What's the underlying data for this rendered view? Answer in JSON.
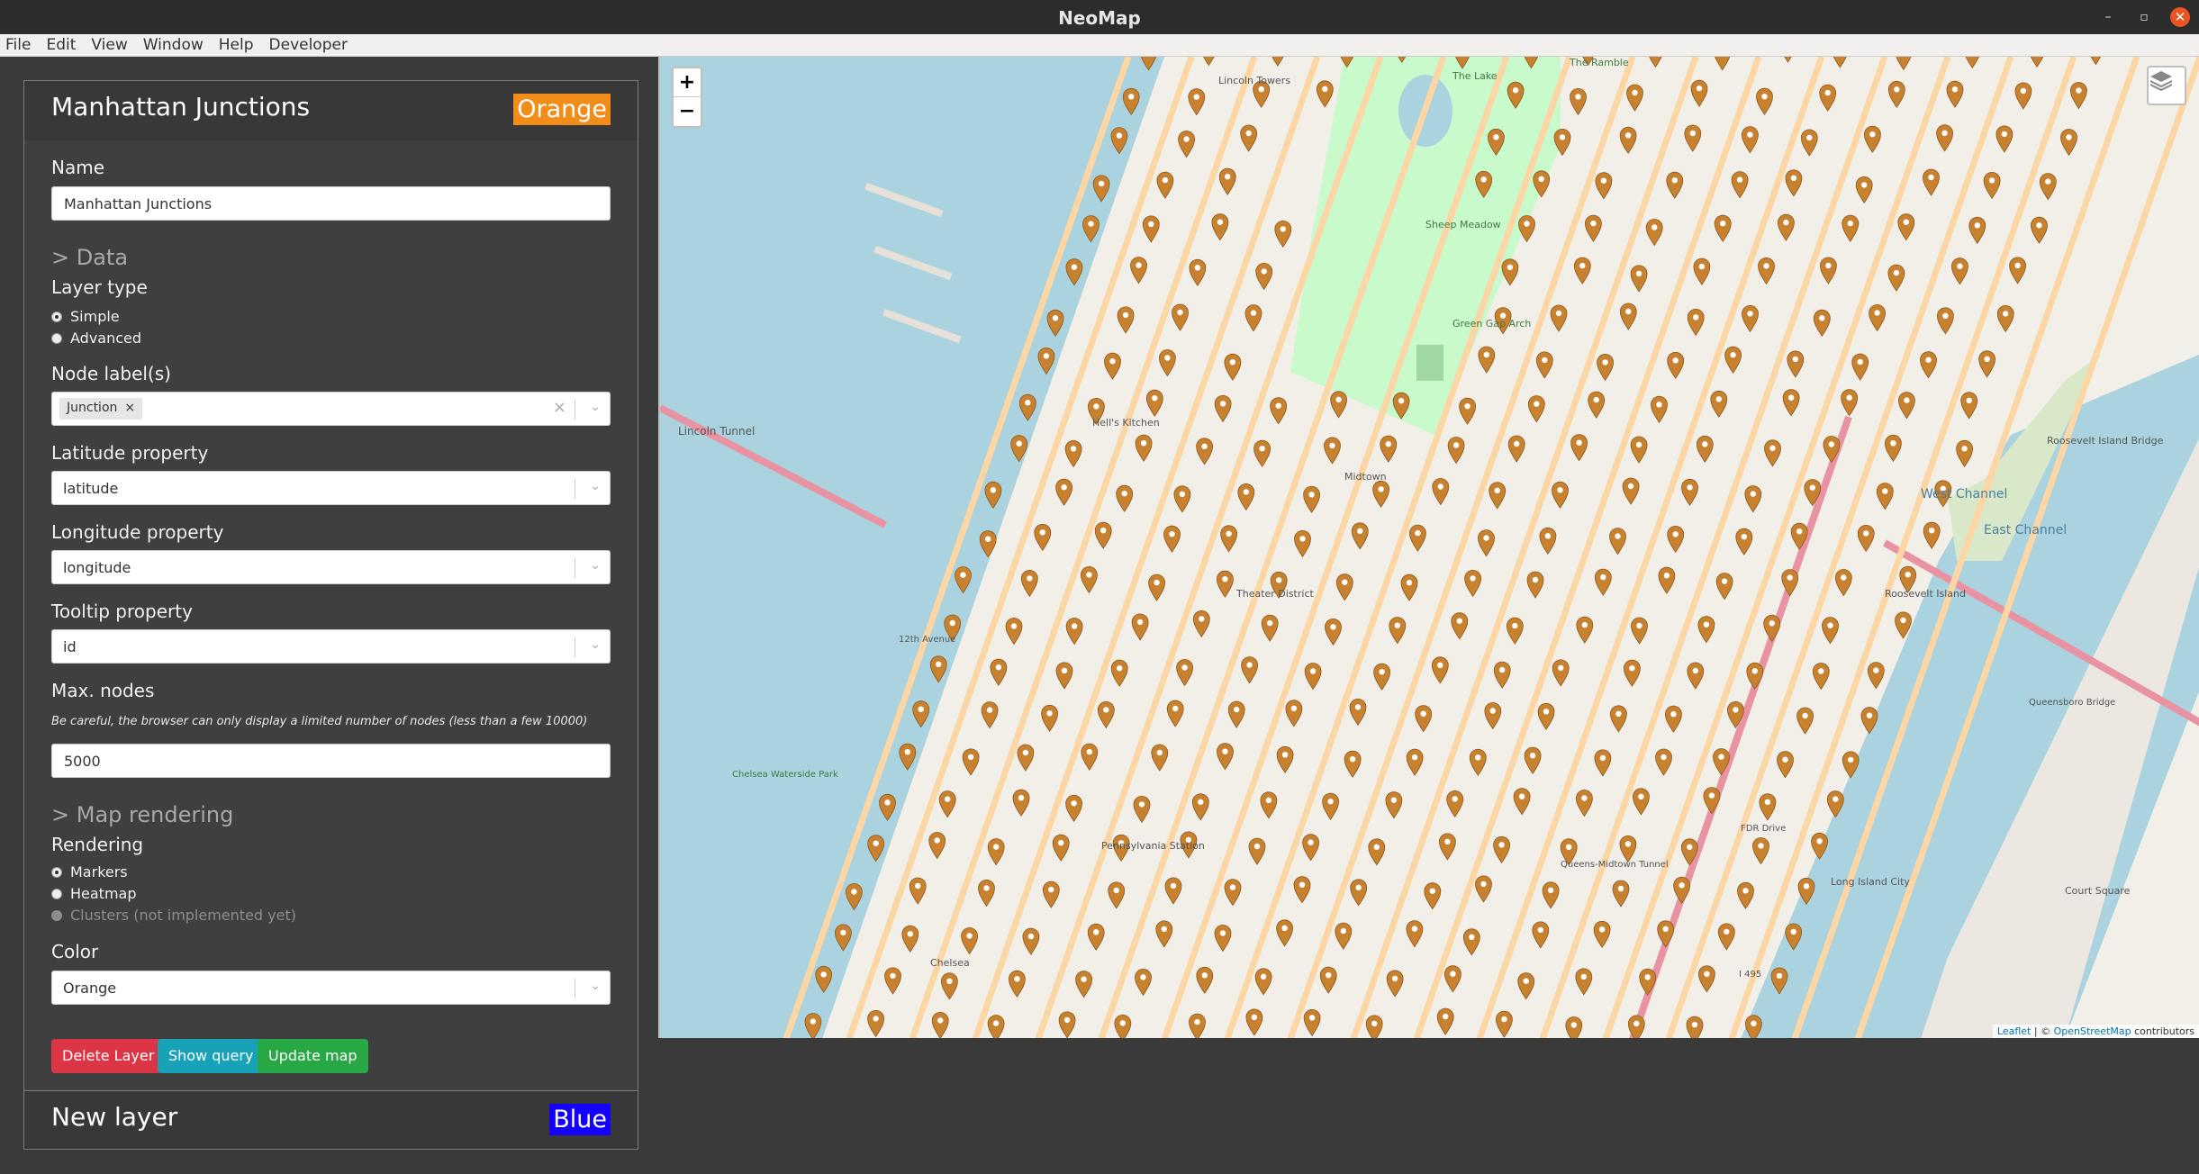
{
  "window": {
    "title": "NeoMap",
    "minimize": "–",
    "maximize": "▫",
    "close": "✕"
  },
  "menu": [
    "File",
    "Edit",
    "View",
    "Window",
    "Help",
    "Developer"
  ],
  "layer": {
    "title": "Manhattan Junctions",
    "color_badge": "Orange",
    "name_label": "Name",
    "name_value": "Manhattan Junctions",
    "data_section": "> Data",
    "layer_type_label": "Layer type",
    "layer_type_options": [
      "Simple",
      "Advanced"
    ],
    "layer_type_selected": "Simple",
    "node_labels_label": "Node label(s)",
    "node_label_chip": "Junction",
    "chip_remove": "×",
    "select_clear": "×",
    "select_arrow": "⌄",
    "lat_label": "Latitude property",
    "lat_value": "latitude",
    "lon_label": "Longitude property",
    "lon_value": "longitude",
    "tooltip_label": "Tooltip property",
    "tooltip_value": "id",
    "max_nodes_label": "Max. nodes",
    "max_nodes_help": "Be careful, the browser can only display a limited number of nodes (less than a few 10000)",
    "max_nodes_value": "5000",
    "map_rendering_section": "> Map rendering",
    "rendering_label": "Rendering",
    "rendering_options": [
      "Markers",
      "Heatmap",
      "Clusters (not implemented yet)"
    ],
    "rendering_selected": "Markers",
    "color_label": "Color",
    "color_value": "Orange",
    "buttons": {
      "delete": "Delete Layer",
      "query": "Show query",
      "update": "Update map"
    }
  },
  "new_layer": {
    "title": "New layer",
    "color_badge": "Blue"
  },
  "map": {
    "zoom_in": "+",
    "zoom_out": "−",
    "attribution_leaflet": "Leaflet",
    "attribution_sep": " | © ",
    "attribution_osm": "OpenStreetMap",
    "attribution_tail": " contributors",
    "labels": [
      "Lincoln Tunnel",
      "West Channel",
      "East Channel",
      "Roosevelt Island",
      "Roosevelt Island Bridge",
      "Theater District",
      "Midtown",
      "Hell's Kitchen",
      "Chelsea",
      "Chelsea Waterside Park",
      "Sheep Meadow",
      "Green Gap Arch",
      "Lincoln Towers",
      "The Lake",
      "The Ramble",
      "Pennsylvania Station",
      "Long Island City",
      "Court Square",
      "Queensboro Bridge",
      "Queens-Midtown Tunnel",
      "I 495",
      "FDR Drive",
      "12th Avenue"
    ],
    "marker_color": "#c7812f",
    "colors": {
      "water": "#aad3df",
      "land": "#f2efe9",
      "park": "#c8facc",
      "avenue": "#fcd6a4",
      "highway": "#e892a2"
    }
  }
}
